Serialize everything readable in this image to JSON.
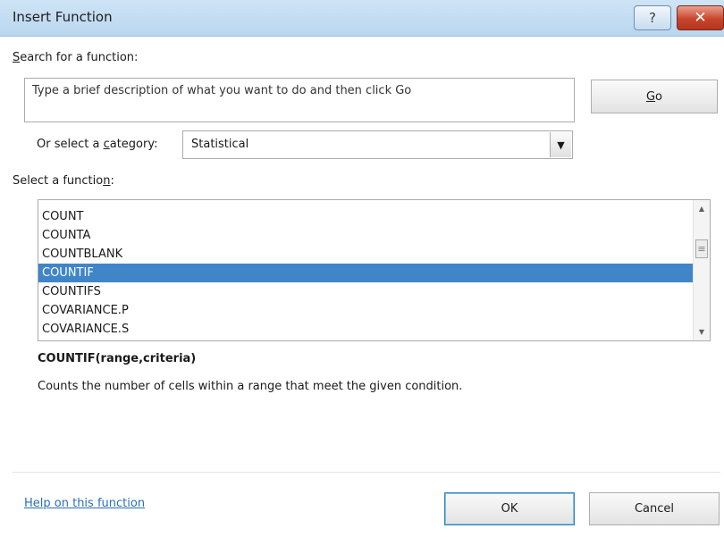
{
  "window": {
    "title": "Insert Function",
    "help_glyph": "?",
    "close_glyph": "✕"
  },
  "search": {
    "label_pre": "",
    "label_accel": "S",
    "label_post": "earch for a function:",
    "value": "Type a brief description of what you want to do and then click Go",
    "go_pre": "",
    "go_accel": "G",
    "go_post": "o"
  },
  "category": {
    "label_pre": "Or select a ",
    "label_accel": "c",
    "label_post": "ategory:",
    "selected": "Statistical"
  },
  "functions": {
    "label_pre": "Select a functio",
    "label_accel": "n",
    "label_post": ":",
    "items": [
      {
        "name": "COUNT",
        "selected": false
      },
      {
        "name": "COUNTA",
        "selected": false
      },
      {
        "name": "COUNTBLANK",
        "selected": false
      },
      {
        "name": "COUNTIF",
        "selected": true
      },
      {
        "name": "COUNTIFS",
        "selected": false
      },
      {
        "name": "COVARIANCE.P",
        "selected": false
      },
      {
        "name": "COVARIANCE.S",
        "selected": false
      }
    ]
  },
  "details": {
    "signature": "COUNTIF(range,criteria)",
    "description": "Counts the number of cells within a range that meet the given condition."
  },
  "footer": {
    "help_link": "Help on this function",
    "ok_label": "OK",
    "cancel_label": "Cancel"
  },
  "colors": {
    "selection": "#3f85c8",
    "link": "#2a6fb5",
    "close": "#c8452c"
  }
}
